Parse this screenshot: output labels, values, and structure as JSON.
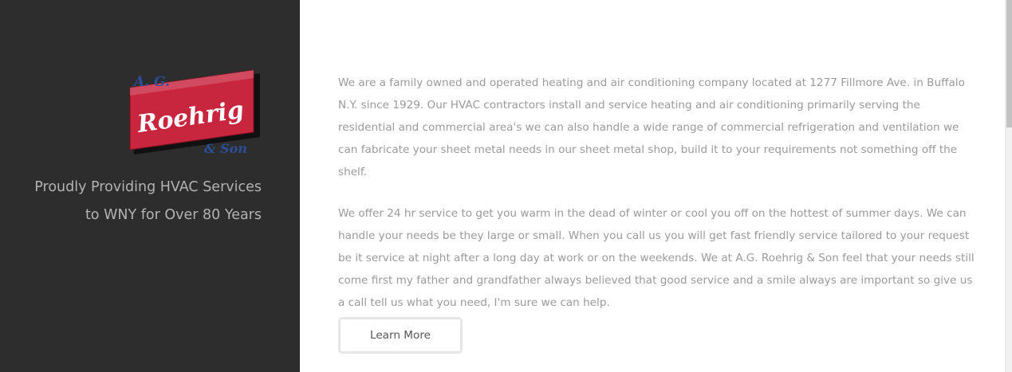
{
  "logo": {
    "top_text": "A. G.",
    "main_text": "Roehrig",
    "bottom_text": "& Son",
    "colors": {
      "red": "#c8253e",
      "blue": "#2b4f9b",
      "white": "#ffffff"
    }
  },
  "tagline": {
    "line1": "Proudly Providing HVAC Services",
    "line2": "to WNY for Over 80 Years"
  },
  "main": {
    "paragraph1": "We are a family owned and operated heating and air conditioning company located at 1277 Fillmore Ave. in Buffalo N.Y. since 1929. Our HVAC contractors install and service heating and air conditioning primarily serving the residential and commercial area's we can also handle a wide range of commercial refrigeration and ventilation we can fabricate your sheet metal needs in our sheet metal shop, build it to your requirements not something off the shelf.",
    "paragraph2": "We offer 24 hr service to get you warm in the dead of winter or cool you off on the hottest of summer days. We can handle your needs be they large or small. When you call us you will get fast friendly service tailored to your request be it service at night after a long day at work or on the weekends. We at A.G. Roehrig & Son feel that your needs still come first my father and grandfather always believed that good service and a smile always are important so give us a call tell us what you need, I'm sure we can help.",
    "button_label": "Learn More"
  },
  "colors": {
    "sidebar_bg": "#2d2d2d",
    "text_gray": "#9a9a9a",
    "tagline_gray": "#b3b3b3"
  }
}
